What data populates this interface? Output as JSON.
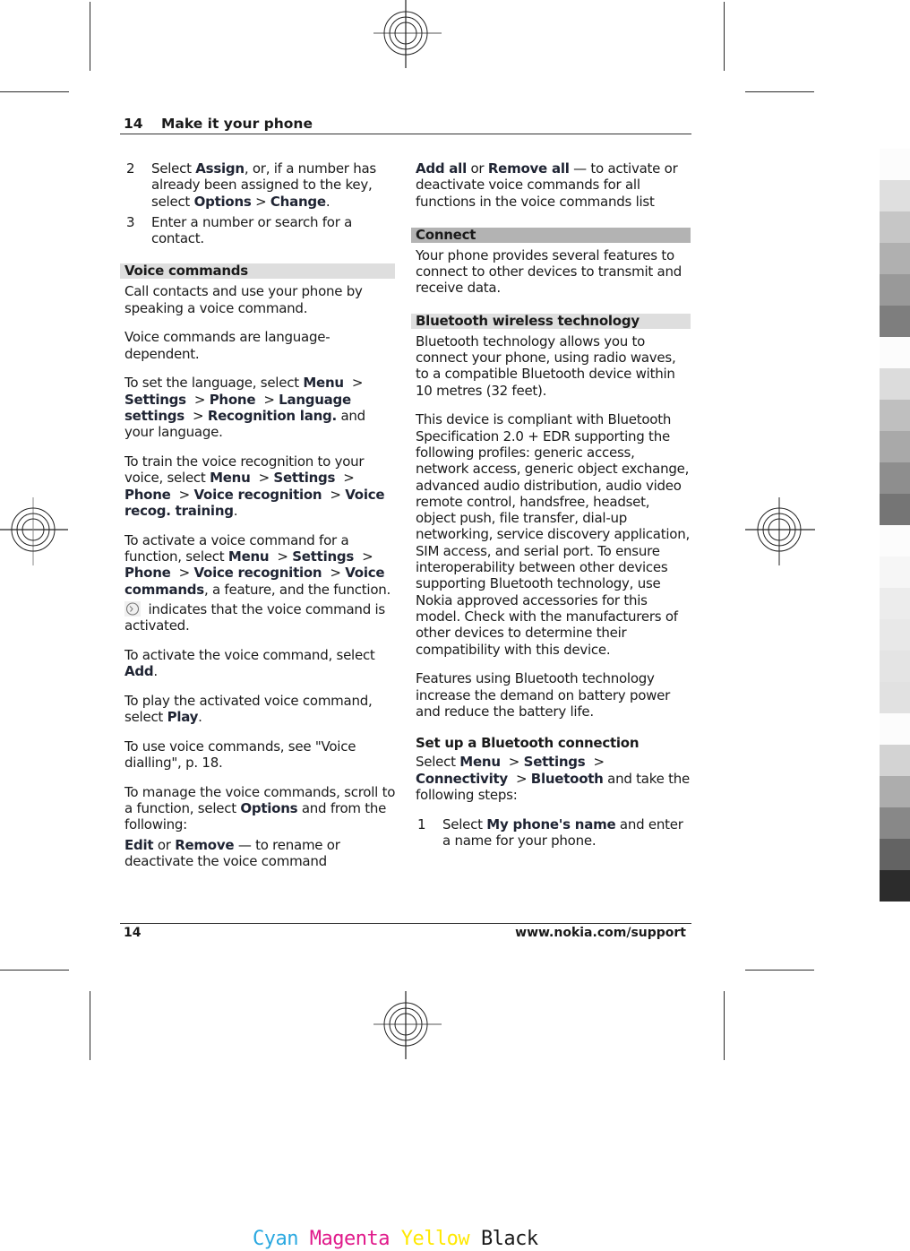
{
  "header": {
    "page_number": "14",
    "title": "Make it your phone"
  },
  "left_column": {
    "steps": [
      {
        "n": "2",
        "html_parts": [
          "Select ",
          "Assign",
          ", or, if a number has already been assigned to the key, select ",
          "Options",
          "  > ",
          "Change",
          "."
        ]
      },
      {
        "n": "3",
        "text": "Enter a number or search for a contact."
      }
    ],
    "section_voice": "Voice commands",
    "p1": "Call contacts and use your phone by speaking a voice command.",
    "p2": "Voice commands are language-dependent.",
    "p3": {
      "a": "To set the language, select ",
      "menu": "Menu",
      "settings": "Settings",
      "phone": "Phone",
      "lang_settings": "Language settings",
      "recog_lang": "Recognition lang.",
      "b": " and your language."
    },
    "p4": {
      "a": "To train the voice recognition to your voice, select ",
      "menu": "Menu",
      "settings": "Settings",
      "phone": "Phone",
      "voice_recog": "Voice recognition",
      "training": "Voice recog. training",
      "b": "."
    },
    "p5": {
      "a": "To activate a voice command for a function, select ",
      "menu": "Menu",
      "settings": "Settings",
      "phone": "Phone",
      "voice_recog": "Voice recognition",
      "voice_cmds": "Voice commands",
      "b": ", a feature, and the function.",
      "icon": "voice-command-active-icon",
      "c": " indicates that the voice command is activated."
    },
    "p6": {
      "a": "To activate the voice command, select ",
      "add": "Add",
      "b": "."
    },
    "p7": {
      "a": "To play the activated voice command, select ",
      "play": "Play",
      "b": "."
    },
    "p8": "To use voice commands, see \"Voice dialling\", p. 18.",
    "p9": {
      "a": "To manage the voice commands, scroll to a function, select ",
      "options": "Options",
      "b": " and from the following:"
    },
    "p10": {
      "edit": "Edit",
      "or": " or ",
      "remove": "Remove",
      "b": " — to rename or deactivate the voice command"
    }
  },
  "right_column": {
    "p1": {
      "add_all": "Add all",
      "or": " or ",
      "remove_all": "Remove all",
      "b": " — to activate or deactivate voice commands for all functions in the voice commands list"
    },
    "section_connect": "Connect",
    "p2": "Your phone provides several features to connect to other devices to transmit and receive data.",
    "section_bt": "Bluetooth wireless technology",
    "p3": "Bluetooth technology allows you to connect your phone, using radio waves, to a compatible Bluetooth device within 10 metres (32 feet).",
    "p4": "This device is compliant with Bluetooth Specification 2.0 + EDR supporting the following profiles: generic access, network access, generic object exchange, advanced audio distribution, audio video remote control, handsfree, headset, object push, file transfer, dial-up networking, service discovery application, SIM access, and serial port. To ensure interoperability between other devices supporting Bluetooth technology, use Nokia approved accessories for this model. Check with the manufacturers of other devices to determine their compatibility with this device.",
    "p5": "Features using Bluetooth technology increase the demand on battery power and reduce the battery life.",
    "sub_setup": "Set up a Bluetooth connection",
    "p6": {
      "a": "Select ",
      "menu": "Menu",
      "settings": "Settings",
      "connectivity": "Connectivity",
      "bluetooth": "Bluetooth",
      "b": " and take the following steps:"
    },
    "step1": {
      "n": "1",
      "a": "Select ",
      "name": "My phone's name",
      "b": " and enter a name for your phone."
    }
  },
  "footer": {
    "page_number": "14",
    "url": "www.nokia.com/support"
  },
  "print_marks": {
    "gray_strip_colors": [
      "#fcfcfc",
      "#dfdfdf",
      "#c6c6c6",
      "#b0b0b0",
      "#999999",
      "#7e7e7e",
      "#fcfcfc",
      "#dcdcdc",
      "#bfbfbf",
      "#a9a9a9",
      "#8e8e8e",
      "#757575",
      "#fcfcfc",
      "#f6f6f6",
      "#ececec",
      "#e8e8e8",
      "#e4e4e4",
      "#e1e1e1",
      "#fcfcfc",
      "#d3d3d3",
      "#adadad",
      "#888888",
      "#636363",
      "#2c2c2c"
    ],
    "cmyk": [
      {
        "label": "Cyan",
        "color": "#2aa8e0"
      },
      {
        "label": "Magenta",
        "color": "#e0198a"
      },
      {
        "label": "Yellow",
        "color": "#ffe800"
      },
      {
        "label": "Black",
        "color": "#1a1a1a"
      }
    ]
  }
}
